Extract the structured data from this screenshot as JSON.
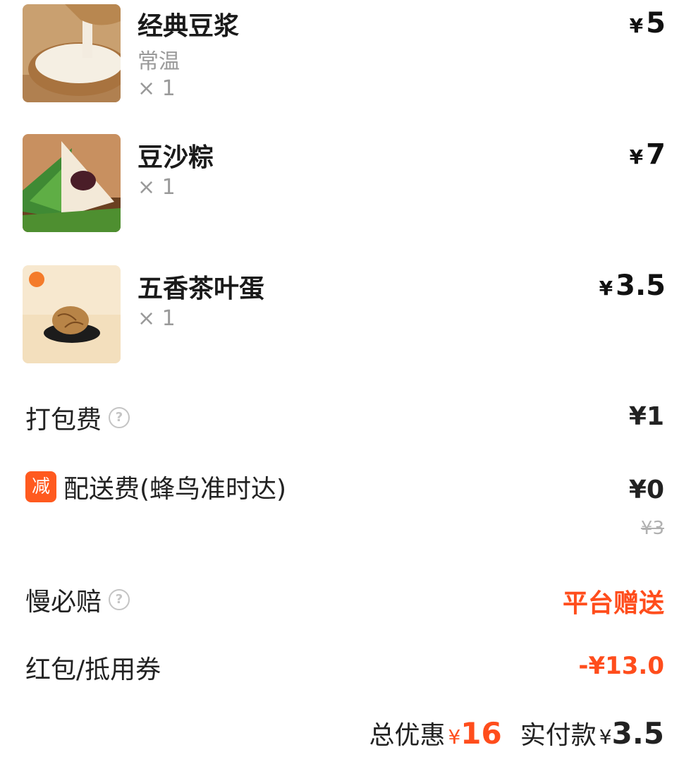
{
  "items": [
    {
      "name": "经典豆浆",
      "spec": "常温",
      "qty": "× 1",
      "currency": "¥",
      "price": "5",
      "image": "soy-milk-photo"
    },
    {
      "name": "豆沙粽",
      "spec": "",
      "qty": "× 1",
      "currency": "¥",
      "price": "7",
      "image": "zongzi-photo"
    },
    {
      "name": "五香茶叶蛋",
      "spec": "",
      "qty": "× 1",
      "currency": "¥",
      "price": "3.5",
      "image": "tea-egg-photo"
    }
  ],
  "fees": {
    "packing_label": "打包费",
    "packing_value": "¥1",
    "delivery_badge": "减",
    "delivery_label": "配送费(蜂鸟准时达)",
    "delivery_value": "¥0",
    "delivery_original": "¥3",
    "late_label": "慢必赔",
    "late_value": "平台赠送",
    "coupon_label": "红包/抵用券",
    "coupon_value": "-¥13.0"
  },
  "summary": {
    "discount_label": "总优惠",
    "discount_currency": "¥",
    "discount_value": "16",
    "paid_label": "实付款",
    "paid_currency": "¥",
    "paid_value": "3.5"
  },
  "colors": {
    "accent": "#ff4d1c",
    "badge": "#ff5a1f",
    "muted": "#9a9a9a"
  },
  "icons": {
    "help": "question-circle-icon"
  }
}
